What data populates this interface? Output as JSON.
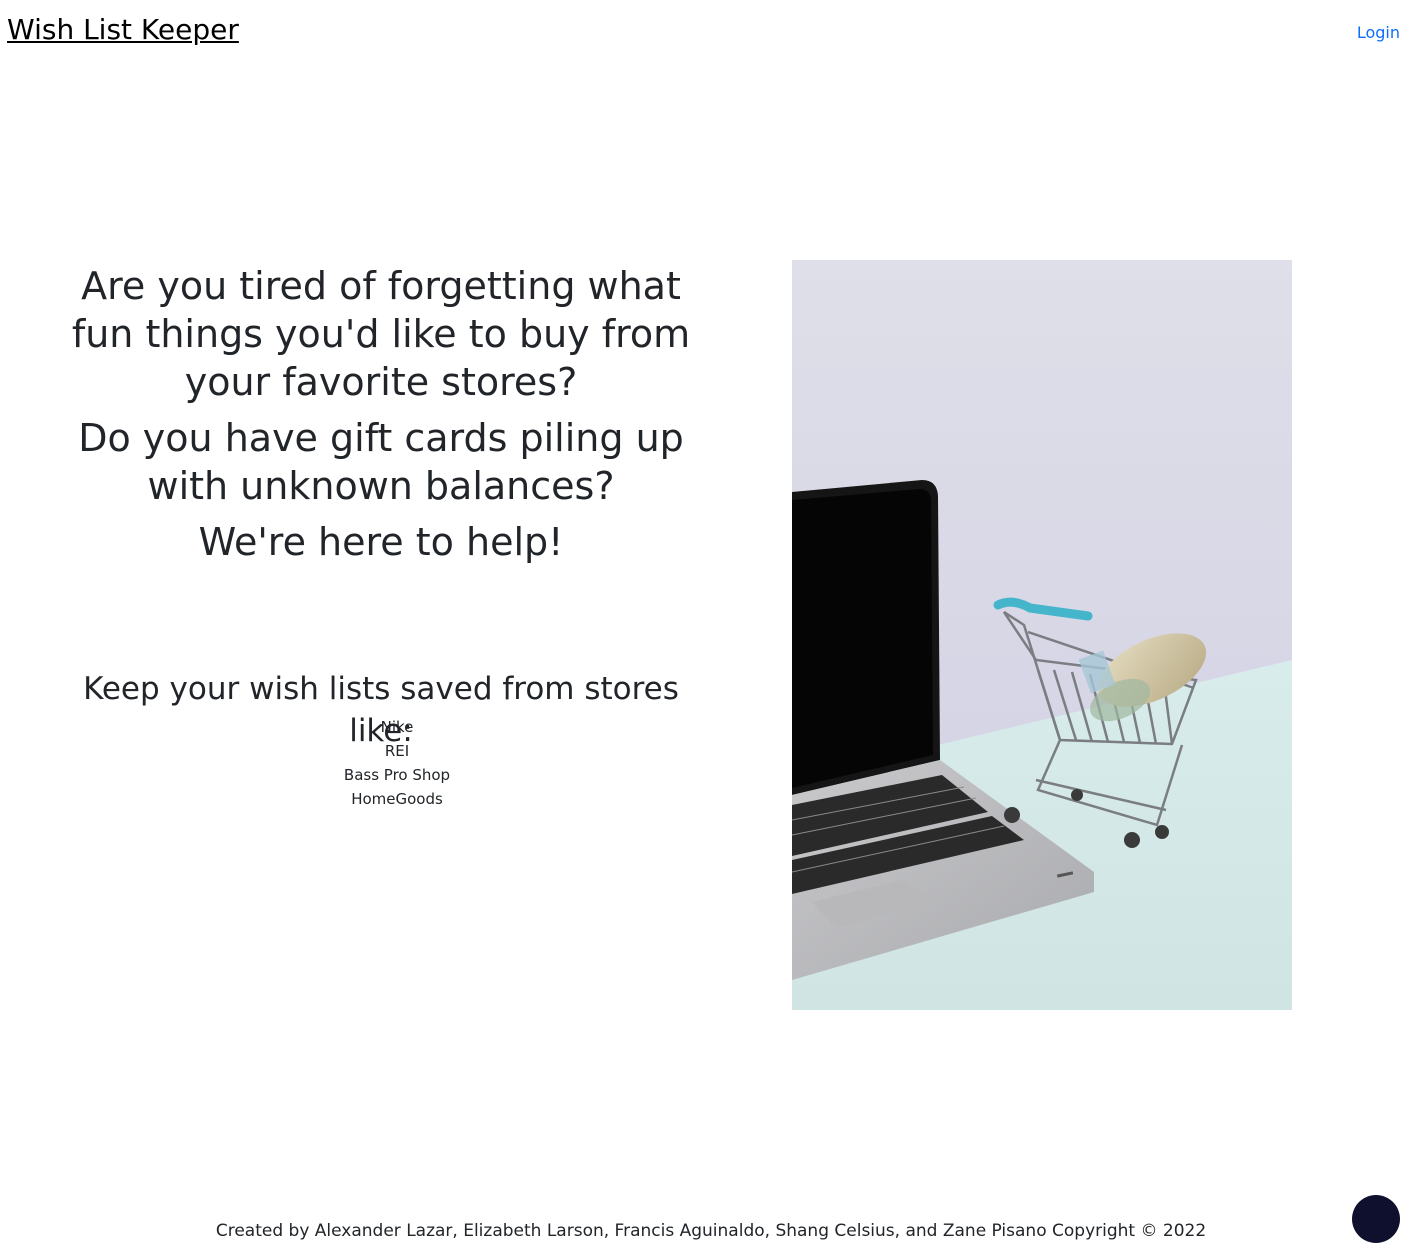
{
  "header": {
    "title": "Wish List Keeper",
    "login_label": "Login"
  },
  "hero": {
    "question_1": "Are you tired of forgetting what fun things you'd like to buy from your favorite stores?",
    "question_2": "Do you have gift cards piling up with unknown balances?",
    "tagline": "We're here to help!"
  },
  "stores": {
    "heading": "Keep your wish lists saved from stores like:",
    "items": [
      "Nike",
      "REI",
      "Bass Pro Shop",
      "HomeGoods"
    ]
  },
  "footer": {
    "credits": "Created by Alexander Lazar, Elizabeth Larson, Francis Aguinaldo, Shang Celsius, and Zane Pisano Copyright © 2022"
  },
  "colors": {
    "link": "#0d6efd",
    "text": "#212529",
    "fab": "#0f0f2e"
  }
}
